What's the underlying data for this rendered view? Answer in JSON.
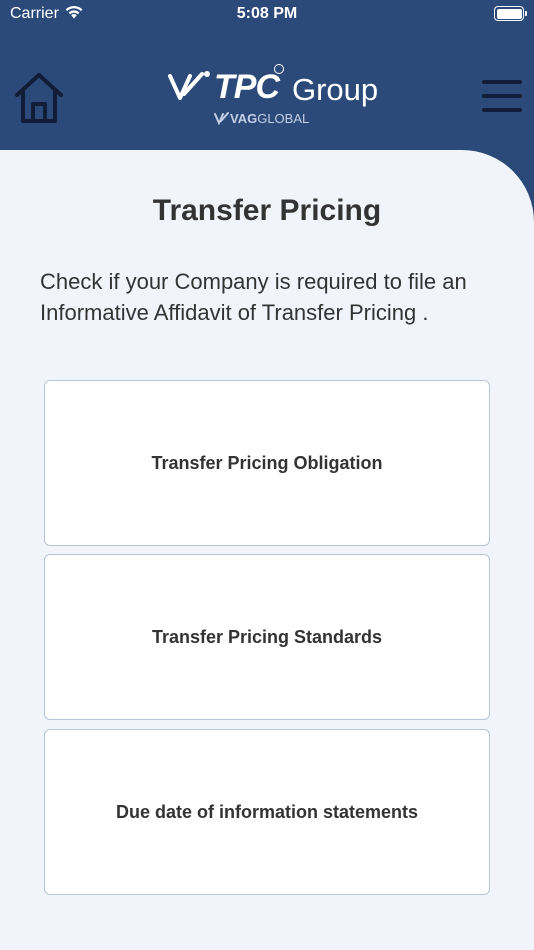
{
  "status_bar": {
    "carrier": "Carrier",
    "time": "5:08 PM"
  },
  "header": {
    "home_icon": "home-icon",
    "menu_icon": "hamburger-menu-icon",
    "logo": {
      "brand": "TPC",
      "group": "Group",
      "sub_prefix": "VAG",
      "sub_suffix": "GLOBAL"
    }
  },
  "main": {
    "title": "Transfer Pricing",
    "description": "Check if your Company is required to file an Informative Affidavit of Transfer Pricing .",
    "cards": [
      {
        "label": "Transfer Pricing Obligation"
      },
      {
        "label": "Transfer Pricing Standards"
      },
      {
        "label": "Due date of information statements"
      }
    ]
  },
  "colors": {
    "header_bg": "#2c4a79",
    "content_bg": "#f1f5fb",
    "card_border": "#b5c5da",
    "text": "#333333"
  }
}
